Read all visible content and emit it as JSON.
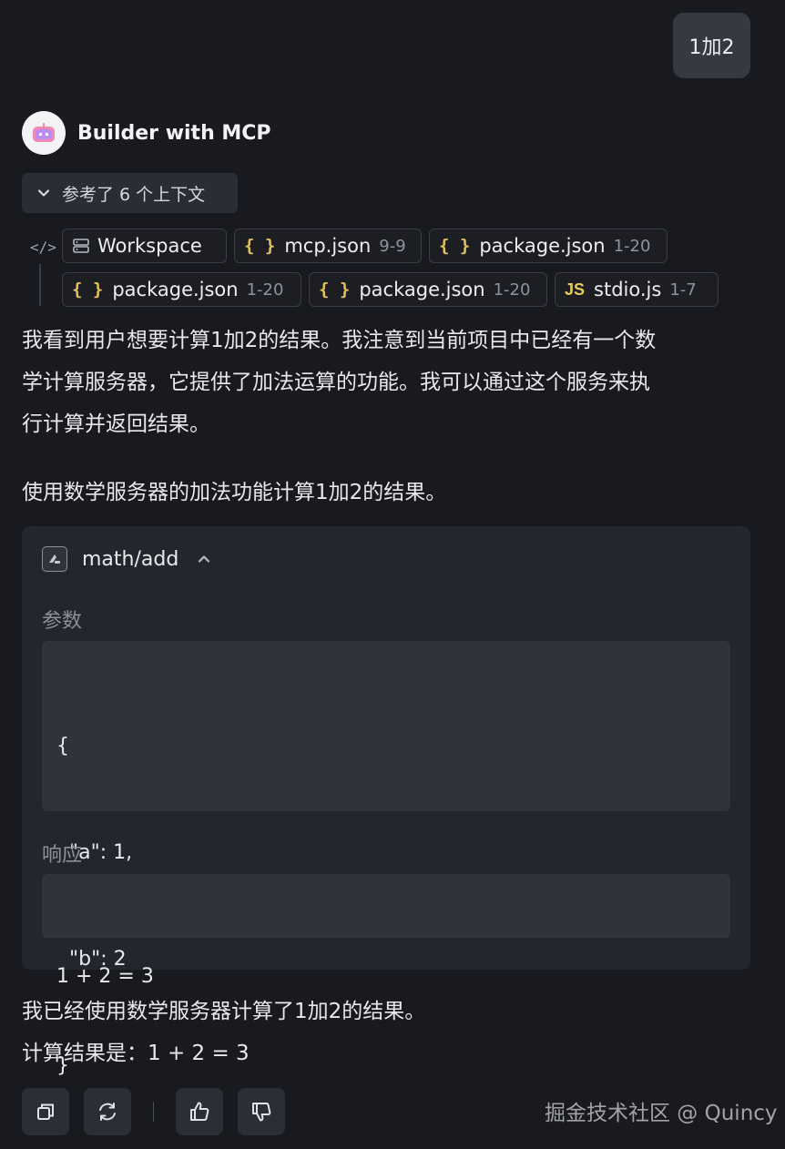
{
  "user_message": "1加2",
  "bot": {
    "name": "Builder with MCP"
  },
  "context": {
    "toggle_label": "参考了 6 个上下文",
    "chips": [
      {
        "icon": "workspace-icon",
        "name": "Workspace",
        "range": ""
      },
      {
        "icon": "braces-icon",
        "icon_text": "{ }",
        "name": "mcp.json",
        "range": "9-9"
      },
      {
        "icon": "braces-icon",
        "icon_text": "{ }",
        "name": "package.json",
        "range": "1-20"
      },
      {
        "icon": "braces-icon",
        "icon_text": "{ }",
        "name": "package.json",
        "range": "1-20"
      },
      {
        "icon": "braces-icon",
        "icon_text": "{ }",
        "name": "package.json",
        "range": "1-20"
      },
      {
        "icon": "js-icon",
        "icon_text": "JS",
        "name": "stdio.js",
        "range": "1-7"
      }
    ]
  },
  "message": {
    "intro_lines": [
      "我看到用户想要计算1加2的结果。我注意到当前项目中已经有一个数",
      "学计算服务器，它提供了加法运算的功能。我可以通过这个服务来执",
      "行计算并返回结果。"
    ],
    "action_line": "使用数学服务器的加法功能计算1加2的结果。",
    "tool_call": {
      "name": "math/add",
      "params_label": "参数",
      "params_lines": [
        "{",
        "  \"a\": 1,",
        "  \"b\": 2",
        "}"
      ],
      "response_label": "响应",
      "response": "1 + 2 = 3"
    },
    "outro_lines": [
      "我已经使用数学服务器计算了1加2的结果。",
      "计算结果是：1 + 2 = 3"
    ]
  },
  "actions": [
    "copy-icon",
    "refresh-icon",
    "thumbs-up-icon",
    "thumbs-down-icon"
  ],
  "watermark": "掘金技术社区 @ Quincy",
  "colors": {
    "background": "#181a1f",
    "bubble": "#363942",
    "card": "#23262d",
    "code_box": "#30333b",
    "braces": "#e2c15c"
  }
}
